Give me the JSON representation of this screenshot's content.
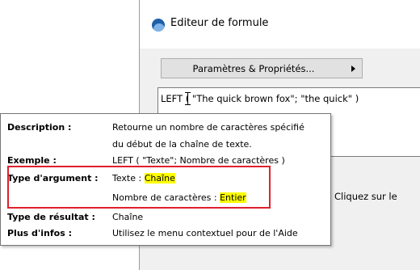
{
  "window": {
    "title": "Editeur de formule",
    "params_button_label": "Paramètres & Propriétés...",
    "formula_before": "LEF",
    "formula_after": "T ( \"The quick brown fox\"; \"the quick\" )",
    "hint_fragment": "r. Cliquez sur le"
  },
  "tooltip": {
    "description_label": "Description :",
    "description_line1": "Retourne un nombre de caractères spécifié",
    "description_line2": "du début de la chaîne de texte.",
    "example_label": "Exemple :",
    "example_value": "LEFT ( \"Texte\"; Nombre de caractères )",
    "argument_type_label": "Type d'argument :",
    "arg1_name": "Texte : ",
    "arg1_type": "Chaîne",
    "arg2_name": "Nombre de caractères : ",
    "arg2_type": "Entier",
    "result_type_label": "Type de résultat :",
    "result_type_value": "Chaîne",
    "more_info_label": "Plus d'infos :",
    "more_info_value": "Utilisez le menu contextuel pour de l'Aide"
  },
  "colors": {
    "highlight_fill": "#ffff00",
    "highlight_border": "#e0202e",
    "app_icon": "#1d5fa8"
  },
  "icons": [
    "app-logo-icon",
    "submenu-arrow-icon",
    "text-cursor-icon"
  ]
}
